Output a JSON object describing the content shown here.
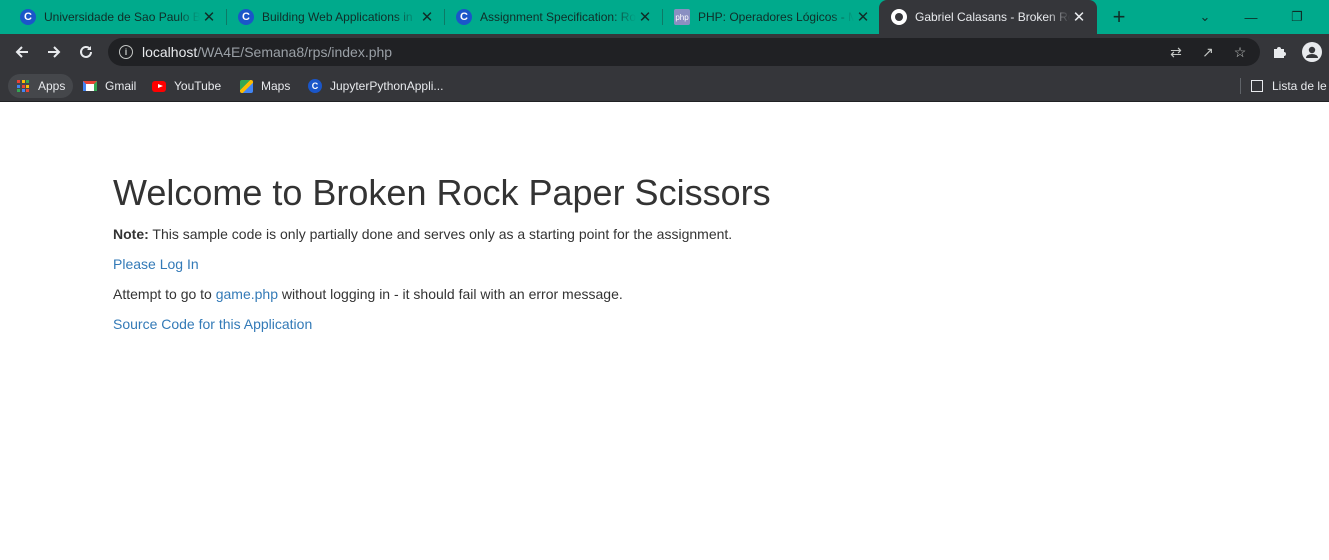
{
  "tabs": [
    {
      "title": "Universidade de Sao Paulo Br",
      "icon": "c-favicon-icon"
    },
    {
      "title": "Building Web Applications in",
      "icon": "c-favicon-icon"
    },
    {
      "title": "Assignment Specification: Ro",
      "icon": "c-favicon-icon"
    },
    {
      "title": "PHP: Operadores Lógicos - M",
      "icon": "php-favicon-icon"
    },
    {
      "title": "Gabriel Calasans - Broken Ro",
      "icon": "globe-icon",
      "active": true
    }
  ],
  "omnibox": {
    "host": "localhost",
    "path": "/WA4E/Semana8/rps/index.php"
  },
  "bookmarks": {
    "items": [
      "Apps",
      "Gmail",
      "YouTube",
      "Maps",
      "JupyterPythonAppli..."
    ],
    "reading_list": "Lista de le"
  },
  "content": {
    "heading": "Welcome to Broken Rock Paper Scissors",
    "note_label": "Note:",
    "note_text": " This sample code is only partially done and serves only as a starting point for the assignment.",
    "login_link": "Please Log In",
    "attempt_prefix": "Attempt to go to ",
    "attempt_link": "game.php",
    "attempt_suffix": " without logging in - it should fail with an error message.",
    "source_link": "Source Code for this Application"
  },
  "colors": {
    "tabstrip": "#00aa8c",
    "toolbar": "#35363a",
    "link": "#337ab7",
    "text": "#333333"
  }
}
